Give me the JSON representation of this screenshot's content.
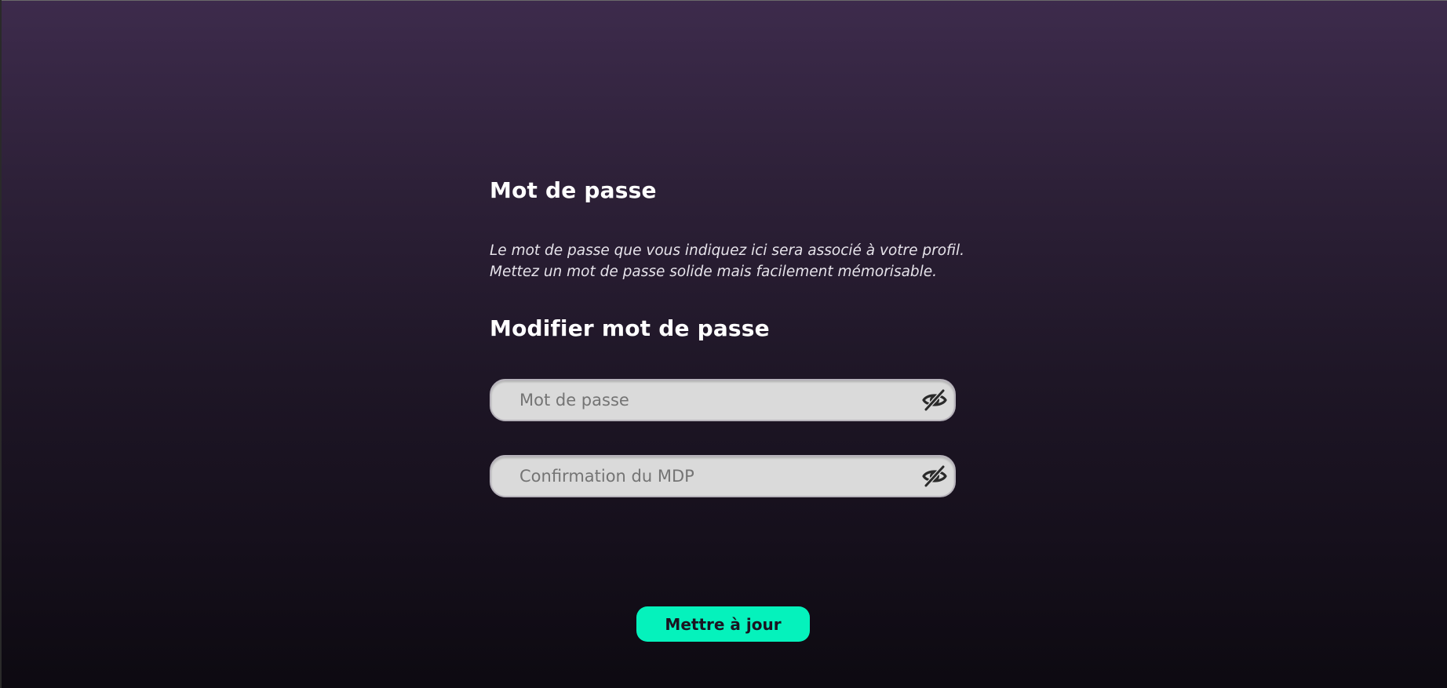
{
  "section": {
    "title": "Mot de passe",
    "description_line1": "Le mot de passe que vous indiquez ici sera associé à votre profil.",
    "description_line2": "Mettez un mot de passe solide mais facilement mémorisable."
  },
  "form": {
    "title": "Modifier mot de passe",
    "password": {
      "value": "",
      "placeholder": "Mot de passe",
      "toggle_icon": "eye-slash-icon"
    },
    "confirm": {
      "value": "",
      "placeholder": "Confirmation du MDP",
      "toggle_icon": "eye-slash-icon"
    },
    "submit_label": "Mettre à jour"
  },
  "colors": {
    "accent": "#05f2bc",
    "background_top": "#3d2b4c",
    "background_bottom": "#0d0a11",
    "input_bg": "#dadada"
  }
}
